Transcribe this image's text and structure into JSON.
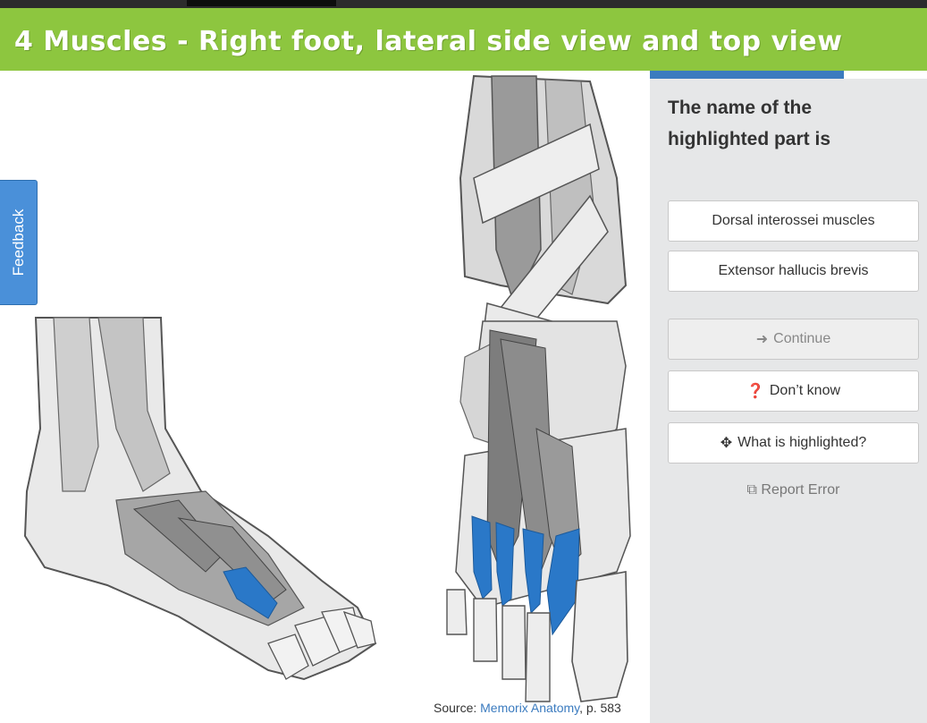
{
  "title": "4 Muscles - Right foot, lateral side view and top view",
  "feedback_label": "Feedback",
  "source": {
    "prefix": "Source:",
    "link_text": "Memorix Anatomy",
    "suffix": ", p. 583"
  },
  "progress": {
    "fraction": 0.7,
    "color": "#3b7bbf"
  },
  "question": "The name of the highlighted part is",
  "answers": [
    {
      "label": "Dorsal interossei muscles"
    },
    {
      "label": "Extensor hallucis brevis"
    }
  ],
  "actions": {
    "continue": "Continue",
    "dont_know": "Don’t know",
    "what_highlighted": "What is highlighted?",
    "report": "Report Error"
  },
  "colors": {
    "banner": "#8dc63f",
    "highlight": "#2a78c8",
    "feedback": "#4a90d9"
  }
}
